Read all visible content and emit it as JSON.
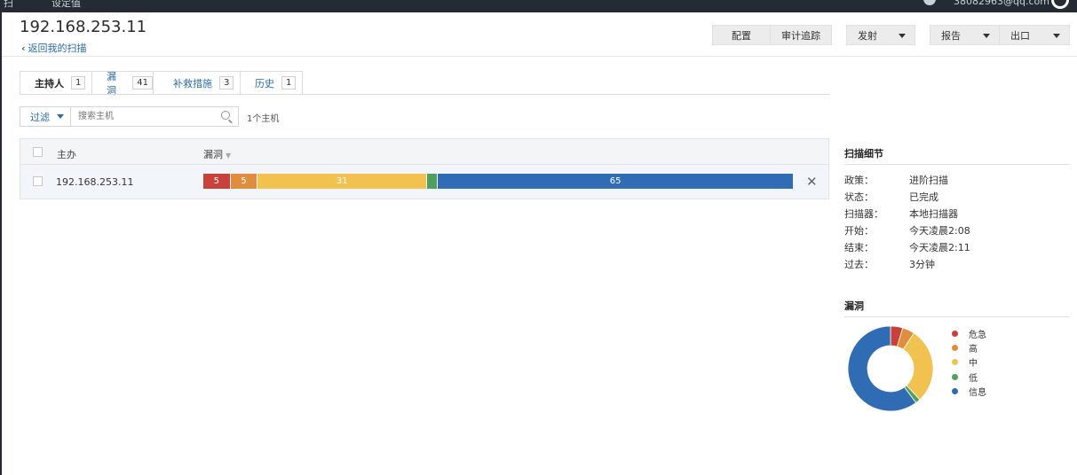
{
  "topbar": {
    "left_text": "扫",
    "left_text2": "设定值",
    "user": "38082963@qq.com"
  },
  "header": {
    "title": "192.168.253.11",
    "back_link": "返回我的扫描",
    "buttons": {
      "configure": "配置",
      "audit": "审计追踪",
      "launch": "发射",
      "report": "报告",
      "export": "出口"
    }
  },
  "tabs": [
    {
      "label": "主持人",
      "count": "1"
    },
    {
      "label": "漏洞",
      "count": "41"
    },
    {
      "label": "补救措施",
      "count": "3"
    },
    {
      "label": "历史",
      "count": "1"
    }
  ],
  "filter": {
    "label": "过滤",
    "search_placeholder": "搜索主机",
    "host_count": "1个主机"
  },
  "table": {
    "col_host": "主办",
    "col_vulns": "漏洞",
    "sort_indicator": "▼",
    "rows": [
      {
        "host": "192.168.253.11",
        "segments": [
          {
            "severity": "critical",
            "count": 5,
            "label": "5"
          },
          {
            "severity": "high",
            "count": 5,
            "label": "5"
          },
          {
            "severity": "medium",
            "count": 31,
            "label": "31"
          },
          {
            "severity": "low",
            "count": 2,
            "label": ""
          },
          {
            "severity": "info",
            "count": 65,
            "label": "65"
          }
        ]
      }
    ]
  },
  "scan_details": {
    "title": "扫描细节",
    "items": [
      {
        "key": "政策：",
        "value": "进阶扫描"
      },
      {
        "key": "状态：",
        "value": "已完成"
      },
      {
        "key": "扫描器：",
        "value": "本地扫描器"
      },
      {
        "key": "开始：",
        "value": "今天凌晨2:08"
      },
      {
        "key": "结束：",
        "value": "今天凌晨2:11"
      },
      {
        "key": "过去：",
        "value": "3分钟"
      }
    ]
  },
  "vuln_chart": {
    "title": "漏洞",
    "legend": [
      {
        "label": "危急",
        "color": "#c9413a"
      },
      {
        "label": "高",
        "color": "#e08e3e"
      },
      {
        "label": "中",
        "color": "#f1c24f"
      },
      {
        "label": "低",
        "color": "#4ea05c"
      },
      {
        "label": "信息",
        "color": "#2f6cb3"
      }
    ]
  },
  "chart_data": {
    "type": "pie",
    "title": "漏洞",
    "categories": [
      "危急",
      "高",
      "中",
      "低",
      "信息"
    ],
    "values": [
      5,
      5,
      31,
      2,
      65
    ],
    "colors": [
      "#c9413a",
      "#e08e3e",
      "#f1c24f",
      "#4ea05c",
      "#2f6cb3"
    ]
  }
}
